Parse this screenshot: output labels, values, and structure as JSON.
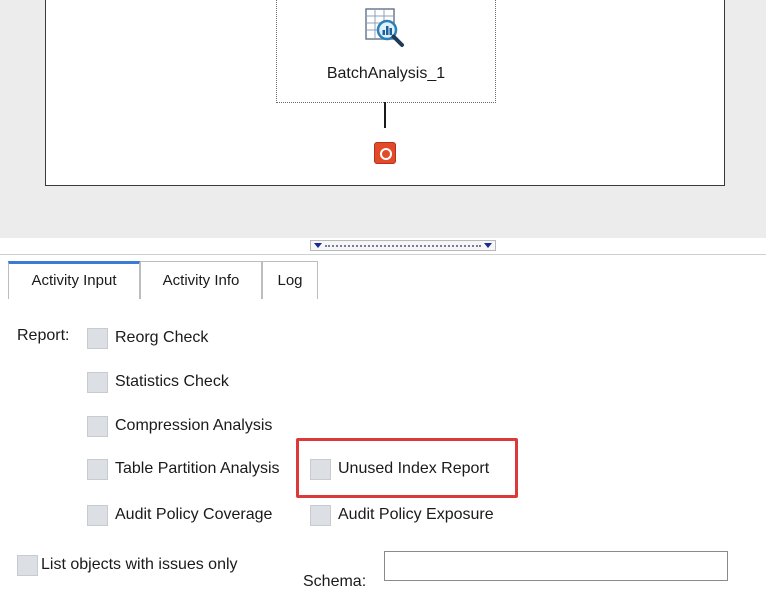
{
  "workflow": {
    "node_label": "BatchAnalysis_1",
    "node_icon": "report-analysis-icon",
    "end_icon": "stop-icon"
  },
  "tabs": [
    {
      "label": "Activity Input",
      "active": true
    },
    {
      "label": "Activity Info",
      "active": false
    },
    {
      "label": "Log",
      "active": false
    }
  ],
  "report": {
    "label": "Report:",
    "options": {
      "reorg_check": "Reorg Check",
      "statistics_check": "Statistics Check",
      "compression_analysis": "Compression Analysis",
      "table_partition_analysis": "Table Partition Analysis",
      "unused_index_report": "Unused Index Report",
      "audit_policy_coverage": "Audit Policy Coverage",
      "audit_policy_exposure": "Audit Policy Exposure"
    }
  },
  "list_issues_only": "List objects with issues only",
  "schema": {
    "label": "Schema:",
    "value": ""
  },
  "colors": {
    "accent_tab": "#3a7bd5",
    "highlight": "#dc3a3a",
    "end_node": "#e24a2a"
  }
}
